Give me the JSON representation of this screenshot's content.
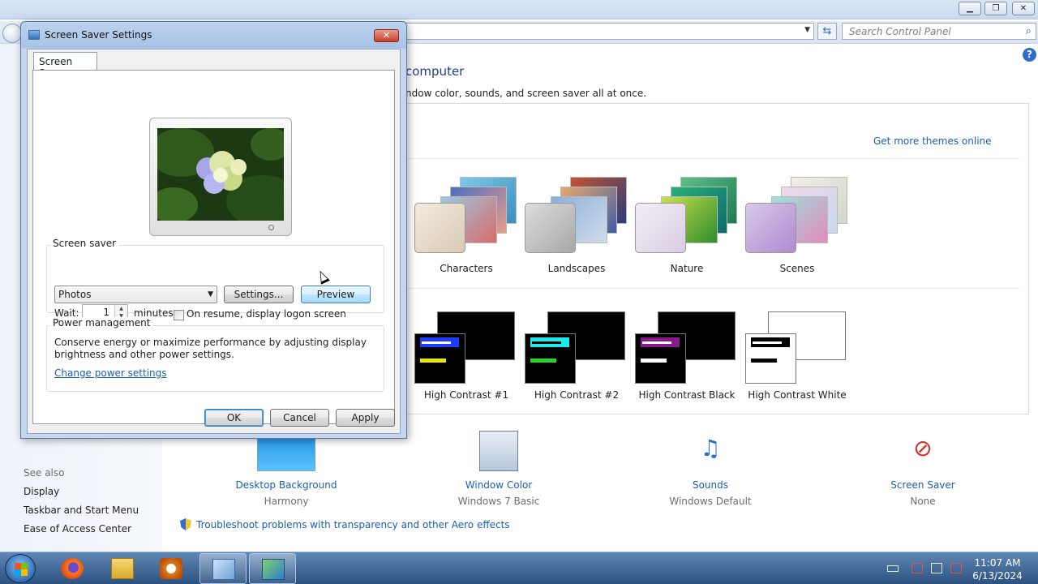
{
  "control_panel": {
    "search_placeholder": "Search Control Panel",
    "heading": "computer",
    "subheading": "ndow color, sounds, and screen saver all at once.",
    "get_more_themes": "Get more themes online",
    "themes": [
      {
        "name": "Characters"
      },
      {
        "name": "Landscapes"
      },
      {
        "name": "Nature"
      },
      {
        "name": "Scenes"
      }
    ],
    "high_contrast_themes": [
      {
        "name": "High Contrast #1"
      },
      {
        "name": "High Contrast #2"
      },
      {
        "name": "High Contrast Black"
      },
      {
        "name": "High Contrast White"
      }
    ],
    "customize": [
      {
        "label": "Desktop Background",
        "value": "Harmony"
      },
      {
        "label": "Window Color",
        "value": "Windows 7 Basic"
      },
      {
        "label": "Sounds",
        "value": "Windows Default"
      },
      {
        "label": "Screen Saver",
        "value": "None"
      }
    ],
    "see_also": {
      "title": "See also",
      "links": [
        "Display",
        "Taskbar and Start Menu",
        "Ease of Access Center"
      ]
    },
    "troubleshoot_link": "Troubleshoot problems with transparency and other Aero effects"
  },
  "dialog": {
    "title": "Screen Saver Settings",
    "tab": "Screen Saver",
    "screen_saver_group": "Screen saver",
    "selected_saver": "Photos",
    "settings_button": "Settings...",
    "preview_button": "Preview",
    "wait_label": "Wait:",
    "wait_value": "1",
    "minutes_label": "minutes",
    "logon_checkbox_label": "On resume, display logon screen",
    "logon_checked": false,
    "power_group": "Power management",
    "power_text_1": "Conserve energy or maximize performance by adjusting display",
    "power_text_2": "brightness and other power settings.",
    "power_link": "Change power settings",
    "ok": "OK",
    "cancel": "Cancel",
    "apply": "Apply"
  },
  "taskbar": {
    "time": "11:07 AM",
    "date": "6/13/2024"
  }
}
